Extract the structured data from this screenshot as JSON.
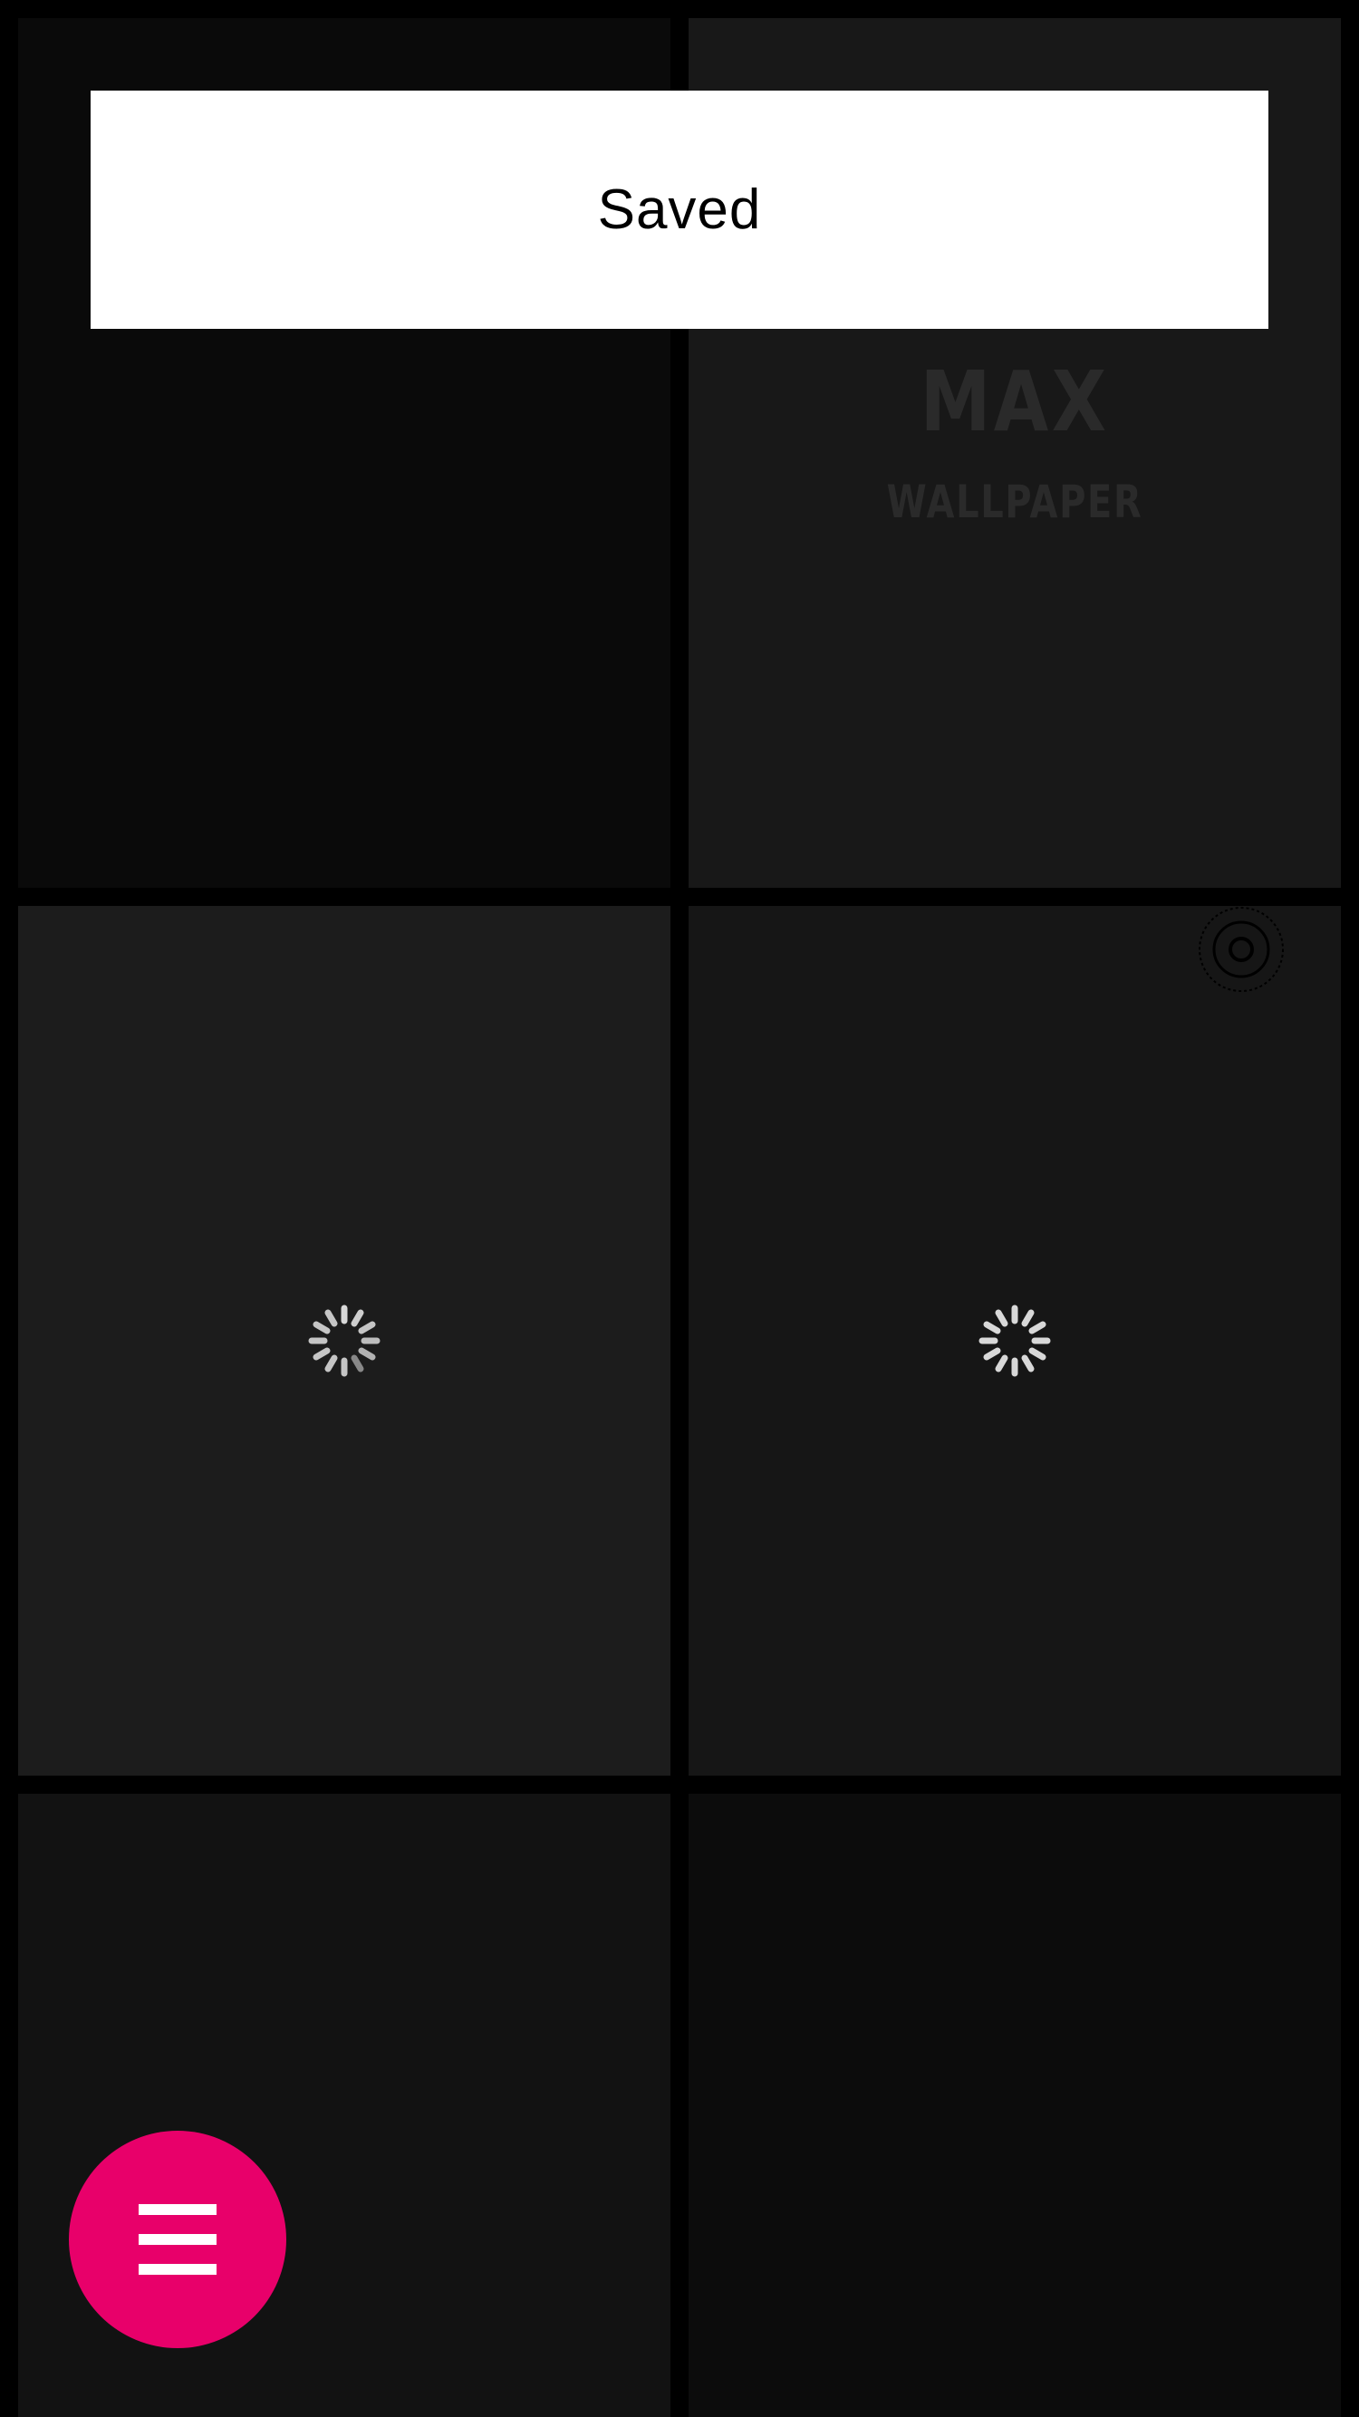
{
  "toast": {
    "message": "Saved"
  },
  "tiles": [
    {
      "state": "image"
    },
    {
      "state": "placeholder-logo",
      "logo": {
        "line1": "MAX",
        "line2": "WALLPAPER"
      }
    },
    {
      "state": "loading"
    },
    {
      "state": "loading",
      "badge_icon": "target-icon"
    },
    {
      "state": "image"
    },
    {
      "state": "image"
    }
  ],
  "fab": {
    "icon": "menu-icon",
    "color": "#e8006a"
  },
  "colors": {
    "background": "#000000",
    "toast_background": "#ffffff",
    "accent": "#e8006a"
  }
}
